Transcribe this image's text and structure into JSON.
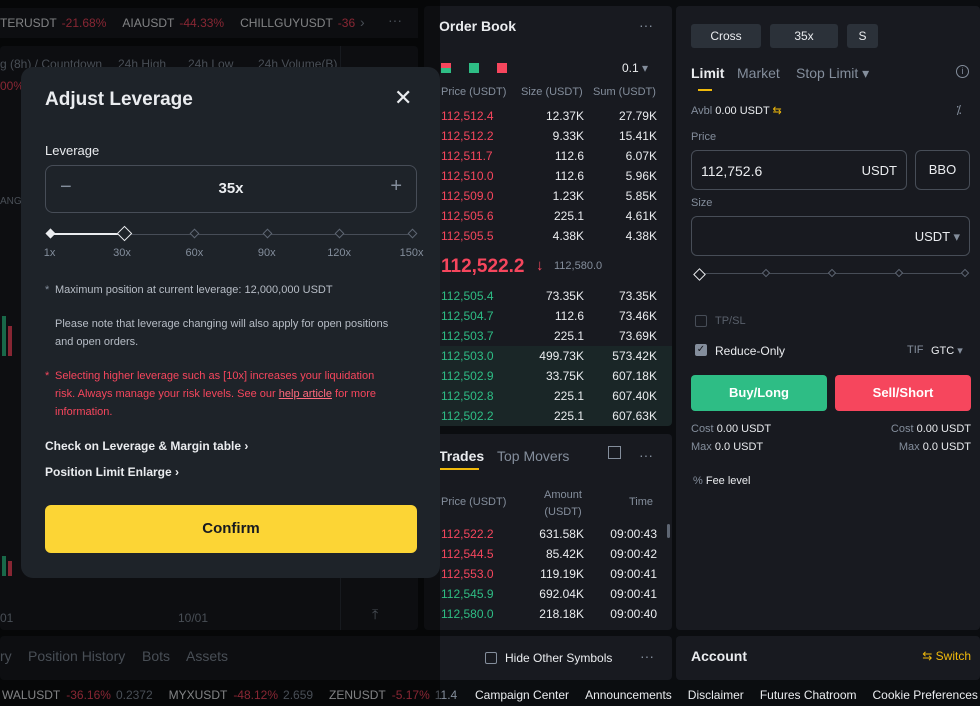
{
  "ticker": [
    {
      "sym": "TERUSDT",
      "chg": "-21.68%"
    },
    {
      "sym": "AIAUSDT",
      "chg": "-44.33%"
    },
    {
      "sym": "CHILLGUYUSDT",
      "chg": "-36"
    }
  ],
  "stats_headers": [
    "g (8h) / Countdown",
    "24h High",
    "24h Low",
    "24h Volume(B)"
  ],
  "stats_fragment": "00%",
  "chart_fragment": "ANGE",
  "chart_date": "10/01",
  "chart_date_left": "01",
  "orderbook": {
    "title": "Order Book",
    "step": "0.1",
    "headers": [
      "Price (USDT)",
      "Size (USDT)",
      "Sum (USDT)"
    ],
    "asks": [
      [
        "112,512.4",
        "12.37K",
        "27.79K"
      ],
      [
        "112,512.2",
        "9.33K",
        "15.41K"
      ],
      [
        "112,511.7",
        "112.6",
        "6.07K"
      ],
      [
        "112,510.0",
        "112.6",
        "5.96K"
      ],
      [
        "112,509.0",
        "1.23K",
        "5.85K"
      ],
      [
        "112,505.6",
        "225.1",
        "4.61K"
      ],
      [
        "112,505.5",
        "4.38K",
        "4.38K"
      ]
    ],
    "mid_price": "112,522.2",
    "mid_arrow": "↓",
    "mid_ref": "112,580.0",
    "bids": [
      [
        "112,505.4",
        "73.35K",
        "73.35K"
      ],
      [
        "112,504.7",
        "112.6",
        "73.46K"
      ],
      [
        "112,503.7",
        "225.1",
        "73.69K"
      ],
      [
        "112,503.0",
        "499.73K",
        "573.42K"
      ],
      [
        "112,502.9",
        "33.75K",
        "607.18K"
      ],
      [
        "112,502.8",
        "225.1",
        "607.40K"
      ],
      [
        "112,502.2",
        "225.1",
        "607.63K"
      ]
    ]
  },
  "trades": {
    "tab_active": "Trades",
    "tab_other": "Top Movers",
    "headers": [
      "Price (USDT)",
      "Amount (USDT)",
      "Time"
    ],
    "rows": [
      {
        "p": "112,522.2",
        "a": "631.58K",
        "t": "09:00:43",
        "side": "sell"
      },
      {
        "p": "112,544.5",
        "a": "85.42K",
        "t": "09:00:42",
        "side": "sell"
      },
      {
        "p": "112,553.0",
        "a": "119.19K",
        "t": "09:00:41",
        "side": "sell"
      },
      {
        "p": "112,545.9",
        "a": "692.04K",
        "t": "09:00:41",
        "side": "buy"
      },
      {
        "p": "112,580.0",
        "a": "218.18K",
        "t": "09:00:40",
        "side": "buy"
      }
    ]
  },
  "order_form": {
    "margin_mode": "Cross",
    "leverage": "35x",
    "mode_s": "S",
    "tabs": [
      "Limit",
      "Market",
      "Stop Limit"
    ],
    "avbl_label": "Avbl",
    "avbl_value": "0.00 USDT",
    "price_label": "Price",
    "price_value": "112,752.6",
    "price_unit": "USDT",
    "bbo": "BBO",
    "size_label": "Size",
    "size_unit": "USDT",
    "tpsl": "TP/SL",
    "reduce_only": "Reduce-Only",
    "tif_label": "TIF",
    "tif_value": "GTC",
    "buy": "Buy/Long",
    "sell": "Sell/Short",
    "cost_label": "Cost",
    "cost_value": "0.00 USDT",
    "max_label": "Max",
    "max_value": "0.0 USDT",
    "fee_level": "Fee level"
  },
  "bottom_tabs": [
    "ry",
    "Position History",
    "Bots",
    "Assets"
  ],
  "hide_other": "Hide Other Symbols",
  "account": {
    "title": "Account",
    "switch": "Switch"
  },
  "footer_tickers": [
    {
      "sym": "WALUSDT",
      "chg": "-36.16%",
      "price": "0.2372"
    },
    {
      "sym": "MYXUSDT",
      "chg": "-48.12%",
      "price": "2.659"
    },
    {
      "sym": "ZENUSDT",
      "chg": "-5.17%",
      "price": "11.4"
    }
  ],
  "footer_links": [
    "Campaign Center",
    "Announcements",
    "Disclaimer",
    "Futures Chatroom",
    "Cookie Preferences"
  ],
  "modal": {
    "title": "Adjust Leverage",
    "leverage_label": "Leverage",
    "value": "35x",
    "slider_marks": [
      "1x",
      "30x",
      "60x",
      "90x",
      "120x",
      "150x"
    ],
    "slider_value": 35,
    "note_max": "Maximum position at current leverage: 12,000,000 USDT",
    "note_open_1": "Please note that leverage changing will also apply for open positions",
    "note_open_2": "and open orders.",
    "warn_1": "Selecting higher leverage such as [10x] increases your liquidation",
    "warn_2a": "risk. Always manage your risk levels. See our ",
    "warn_link": "help article",
    "warn_2b": " for more",
    "warn_3": "information.",
    "link_table": "Check on Leverage & Margin table",
    "link_limit": "Position Limit Enlarge",
    "confirm": "Confirm"
  }
}
